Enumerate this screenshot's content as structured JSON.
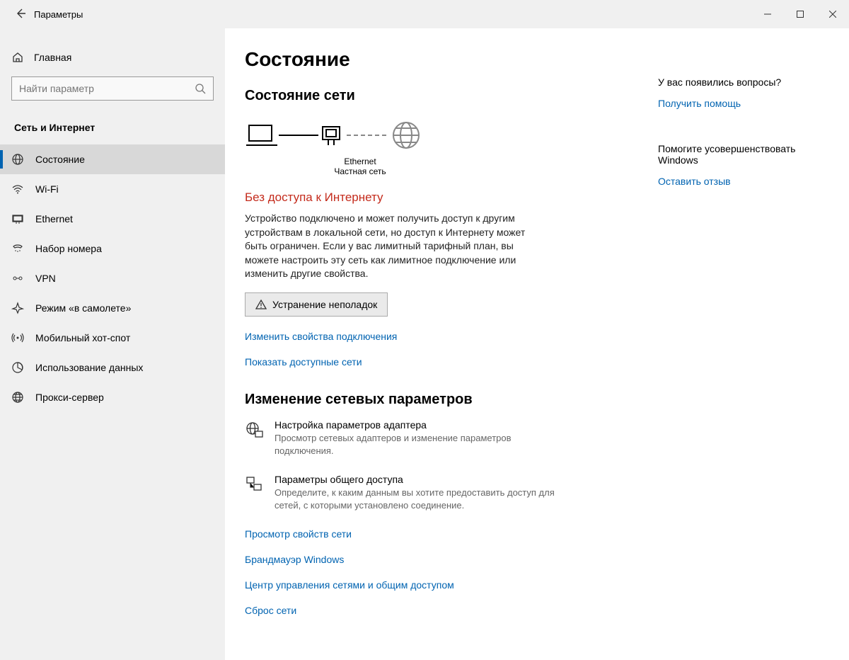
{
  "titlebar": {
    "title": "Параметры"
  },
  "sidebar": {
    "home": "Главная",
    "search_placeholder": "Найти параметр",
    "category": "Сеть и Интернет",
    "items": [
      {
        "label": "Состояние"
      },
      {
        "label": "Wi-Fi"
      },
      {
        "label": "Ethernet"
      },
      {
        "label": "Набор номера"
      },
      {
        "label": "VPN"
      },
      {
        "label": "Режим «в самолете»"
      },
      {
        "label": "Мобильный хот-спот"
      },
      {
        "label": "Использование данных"
      },
      {
        "label": "Прокси-сервер"
      }
    ]
  },
  "main": {
    "page_title": "Состояние",
    "net_section": "Состояние сети",
    "diagram": {
      "adapter": "Ethernet",
      "network_type": "Частная сеть"
    },
    "status_title": "Без доступа к Интернету",
    "status_desc": "Устройство подключено и может получить доступ к другим устройствам в локальной сети, но доступ к Интернету может быть ограничен. Если у вас лимитный тарифный план, вы можете настроить эту сеть как лимитное подключение или изменить другие свойства.",
    "troubleshoot": "Устранение неполадок",
    "link_change_props": "Изменить свойства подключения",
    "link_show_nets": "Показать доступные сети",
    "change_section": "Изменение сетевых параметров",
    "adapter_opt": {
      "title": "Настройка параметров адаптера",
      "desc": "Просмотр сетевых адаптеров и изменение параметров подключения."
    },
    "sharing_opt": {
      "title": "Параметры общего доступа",
      "desc": "Определите, к каким данным вы хотите предоставить доступ для сетей, с которыми установлено соединение."
    },
    "link_props": "Просмотр свойств сети",
    "link_firewall": "Брандмауэр Windows",
    "link_center": "Центр управления сетями и общим доступом",
    "link_reset": "Сброс сети"
  },
  "help": {
    "q_title": "У вас появились вопросы?",
    "q_link": "Получить помощь",
    "fb_title": "Помогите усовершенствовать Windows",
    "fb_link": "Оставить отзыв"
  }
}
